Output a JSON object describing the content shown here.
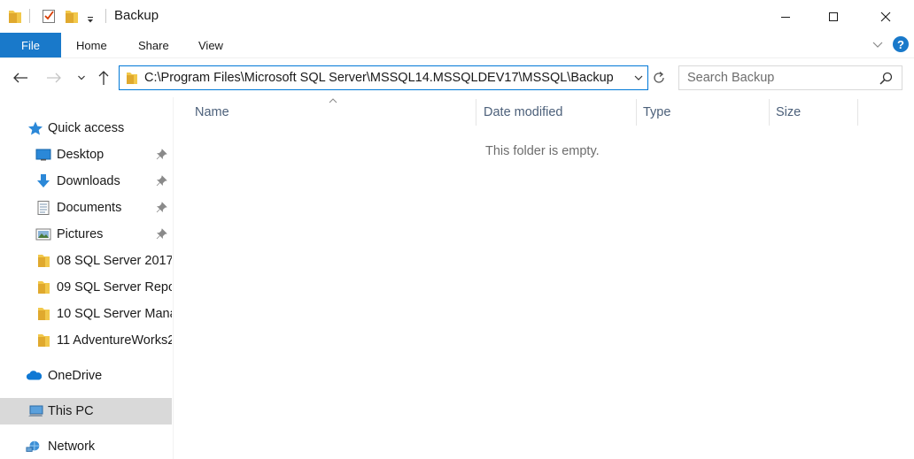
{
  "window": {
    "title": "Backup"
  },
  "ribbon": {
    "tabs": [
      {
        "label": "File"
      },
      {
        "label": "Home"
      },
      {
        "label": "Share"
      },
      {
        "label": "View"
      }
    ],
    "help_label": "?"
  },
  "address": {
    "path": "C:\\Program Files\\Microsoft SQL Server\\MSSQL14.MSSQLDEV17\\MSSQL\\Backup"
  },
  "search": {
    "placeholder": "Search Backup"
  },
  "sidebar": {
    "items": [
      {
        "label": "Quick access",
        "icon": "star-icon"
      },
      {
        "label": "Desktop",
        "icon": "desktop-icon",
        "pinned": true
      },
      {
        "label": "Downloads",
        "icon": "download-icon",
        "pinned": true
      },
      {
        "label": "Documents",
        "icon": "documents-icon",
        "pinned": true
      },
      {
        "label": "Pictures",
        "icon": "pictures-icon",
        "pinned": true
      },
      {
        "label": "08 SQL Server 2017",
        "icon": "folder-icon"
      },
      {
        "label": "09 SQL Server Repo",
        "icon": "folder-icon"
      },
      {
        "label": "10 SQL Server Mana",
        "icon": "folder-icon"
      },
      {
        "label": "11 AdventureWorks2",
        "icon": "folder-icon"
      },
      {
        "label": "OneDrive",
        "icon": "cloud-icon"
      },
      {
        "label": "This PC",
        "icon": "computer-icon",
        "selected": true
      },
      {
        "label": "Network",
        "icon": "network-icon"
      }
    ]
  },
  "columns": [
    {
      "label": "Name"
    },
    {
      "label": "Date modified"
    },
    {
      "label": "Type"
    },
    {
      "label": "Size"
    }
  ],
  "content": {
    "empty_message": "This folder is empty."
  },
  "colors": {
    "accent": "#1979ca",
    "address_border": "#0078d7",
    "folder": "#f2c84b",
    "selected_bg": "#d9d9d9"
  }
}
